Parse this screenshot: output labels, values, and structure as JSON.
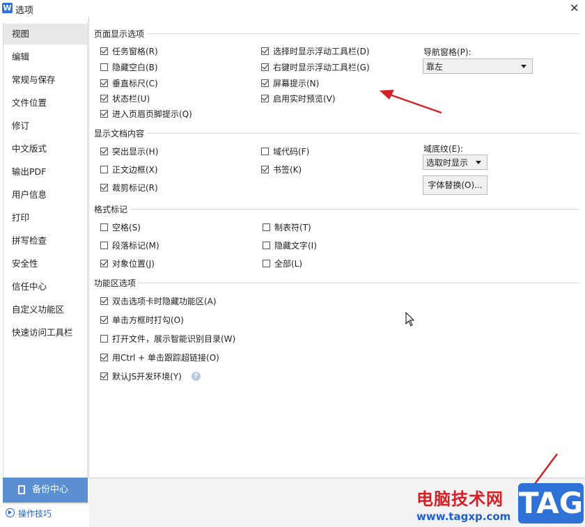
{
  "window": {
    "title": "选项",
    "app_icon": "W"
  },
  "sidebar": {
    "items": [
      {
        "label": "视图"
      },
      {
        "label": "编辑"
      },
      {
        "label": "常规与保存"
      },
      {
        "label": "文件位置"
      },
      {
        "label": "修订"
      },
      {
        "label": "中文版式"
      },
      {
        "label": "输出PDF"
      },
      {
        "label": "用户信息"
      },
      {
        "label": "打印"
      },
      {
        "label": "拼写检查"
      },
      {
        "label": "安全性"
      },
      {
        "label": "信任中心"
      },
      {
        "label": "自定义功能区"
      },
      {
        "label": "快速访问工具栏"
      }
    ],
    "backup_label": "备份中心",
    "tips_label": "操作技巧"
  },
  "page_display": {
    "title": "页面显示选项",
    "options": {
      "task_pane": {
        "label": "任务窗格(R)",
        "checked": true
      },
      "hide_blank": {
        "label": "隐藏空白(B)",
        "checked": false
      },
      "vertical_ruler": {
        "label": "垂直标尺(C)",
        "checked": true
      },
      "status_bar": {
        "label": "状态栏(U)",
        "checked": true
      },
      "header_footer_tip": {
        "label": "进入页眉页脚提示(Q)",
        "checked": true
      },
      "float_toolbar_select": {
        "label": "选择时显示浮动工具栏(D)",
        "checked": true
      },
      "float_toolbar_right": {
        "label": "右键时显示浮动工具栏(G)",
        "checked": true
      },
      "screen_tip": {
        "label": "屏幕提示(N)",
        "checked": true
      },
      "live_preview": {
        "label": "启用实时预览(V)",
        "checked": true
      }
    },
    "nav_pane_label": "导航窗格(P):",
    "nav_pane_value": "靠左"
  },
  "doc_content": {
    "title": "显示文档内容",
    "options": {
      "highlight": {
        "label": "突出显示(H)",
        "checked": true
      },
      "text_border": {
        "label": "正文边框(X)",
        "checked": false
      },
      "crop_marks": {
        "label": "裁剪标记(R)",
        "checked": true
      },
      "field_code": {
        "label": "域代码(F)",
        "checked": false
      },
      "bookmark": {
        "label": "书签(K)",
        "checked": true
      }
    },
    "field_shading_label": "域底纹(E):",
    "field_shading_value": "选取时显示",
    "font_replace_label": "字体替换(O)..."
  },
  "format_marks": {
    "title": "格式标记",
    "options": {
      "space": {
        "label": "空格(S)",
        "checked": false
      },
      "paragraph": {
        "label": "段落标记(M)",
        "checked": false
      },
      "object_pos": {
        "label": "对象位置(J)",
        "checked": true
      },
      "tab_char": {
        "label": "制表符(T)",
        "checked": false
      },
      "hidden_text": {
        "label": "隐藏文字(I)",
        "checked": false
      },
      "all": {
        "label": "全部(L)",
        "checked": false
      }
    }
  },
  "ribbon": {
    "title": "功能区选项",
    "options": {
      "dblclick_hide": {
        "label": "双击选项卡时隐藏功能区(A)",
        "checked": true
      },
      "click_check": {
        "label": "单击方框时打勾(O)",
        "checked": true
      },
      "smart_toc": {
        "label": "打开文件，展示智能识别目录(W)",
        "checked": false
      },
      "ctrl_click_link": {
        "label": "用Ctrl + 单击跟踪超链接(O)",
        "checked": true
      },
      "js_env": {
        "label": "默认JS开发环境(Y)",
        "checked": true
      }
    },
    "help_icon": "?"
  },
  "watermark": {
    "site_name": "电脑技术网",
    "site_url": "www.tagxp.com",
    "tag": "TAG"
  },
  "colors": {
    "arrow": "#d42027",
    "backup_bg": "#5b8fd4",
    "link": "#2a64c8",
    "tag_bg": "#2e72d8"
  }
}
